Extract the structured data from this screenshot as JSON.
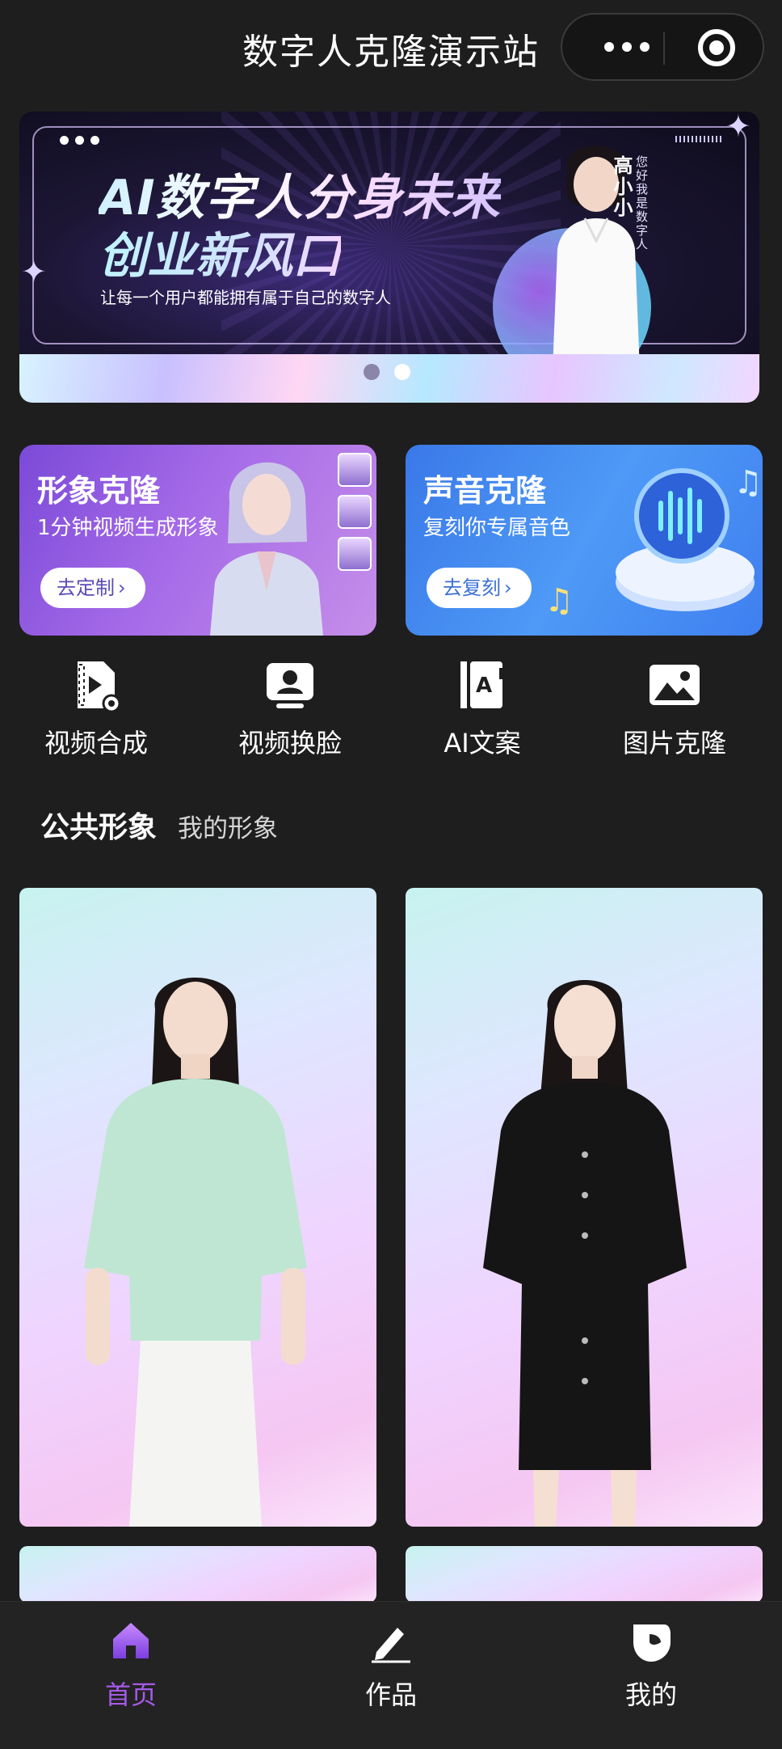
{
  "header": {
    "title": "数字人克隆演示站",
    "more_icon": "more-dots-icon",
    "close_icon": "target-circle-icon"
  },
  "banner": {
    "headline_line1": "AI数字人分身未来",
    "headline_line2": "创业新风口",
    "subtitle": "让每一个用户都能拥有属于自己的数字人",
    "presenter_name": "高小小",
    "presenter_greeting": "您好我是数字人",
    "page_count": 2,
    "active_page": 2
  },
  "feature_cards": [
    {
      "title": "形象克隆",
      "desc": "1分钟视频生成形象",
      "button": "去定制",
      "accent": "#7b4ad8"
    },
    {
      "title": "声音克隆",
      "desc": "复刻你专属音色",
      "button": "去复刻",
      "accent": "#3a78e8"
    }
  ],
  "quick_actions": [
    {
      "label": "视频合成",
      "icon": "video-edit-icon"
    },
    {
      "label": "视频换脸",
      "icon": "face-swap-icon"
    },
    {
      "label": "AI文案",
      "icon": "ai-copywriting-icon"
    },
    {
      "label": "图片克隆",
      "icon": "image-clone-icon"
    }
  ],
  "avatar_tabs": {
    "public": "公共形象",
    "mine": "我的形象"
  },
  "avatars": [
    {
      "outfit": "mint blouse, white skirt"
    },
    {
      "outfit": "black button dress"
    },
    {
      "outfit": ""
    },
    {
      "outfit": ""
    }
  ],
  "tabbar": {
    "items": [
      {
        "label": "首页",
        "icon": "home-icon",
        "active": true
      },
      {
        "label": "作品",
        "icon": "pen-icon",
        "active": false
      },
      {
        "label": "我的",
        "icon": "profile-icon",
        "active": false
      }
    ],
    "active_color": "#a55ae8"
  }
}
